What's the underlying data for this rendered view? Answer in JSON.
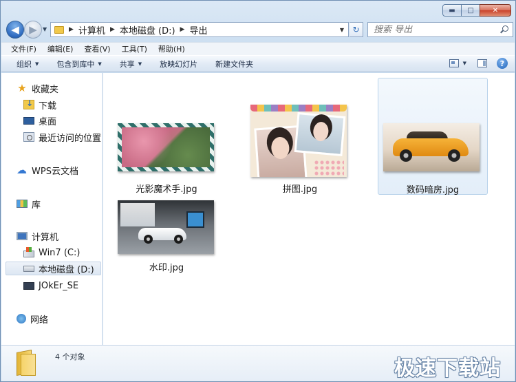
{
  "window": {
    "caption_buttons": {
      "minimize": "▬",
      "maximize": "□",
      "close": "✕"
    }
  },
  "navigation": {
    "back_glyph": "◀",
    "forward_glyph": "▶",
    "breadcrumbs": [
      "计算机",
      "本地磁盘 (D:)",
      "导出"
    ],
    "separator": "▶",
    "dropdown_glyph": "▼",
    "refresh_glyph": "↻",
    "search_placeholder": "搜索 导出"
  },
  "menubar": {
    "items": [
      "文件(F)",
      "编辑(E)",
      "查看(V)",
      "工具(T)",
      "帮助(H)"
    ]
  },
  "commandbar": {
    "items": [
      {
        "label": "组织",
        "has_dropdown": true
      },
      {
        "label": "包含到库中",
        "has_dropdown": true
      },
      {
        "label": "共享",
        "has_dropdown": true
      },
      {
        "label": "放映幻灯片",
        "has_dropdown": false
      },
      {
        "label": "新建文件夹",
        "has_dropdown": false
      }
    ],
    "dropdown_glyph": "▼",
    "help_glyph": "?"
  },
  "sidebar": {
    "favorites": {
      "label": "收藏夹",
      "icon": "star-icon"
    },
    "favorite_items": [
      {
        "label": "下载",
        "icon": "download-folder-icon"
      },
      {
        "label": "桌面",
        "icon": "desktop-icon"
      },
      {
        "label": "最近访问的位置",
        "icon": "recent-places-icon"
      }
    ],
    "wps": {
      "label": "WPS云文档",
      "icon": "cloud-icon"
    },
    "libraries": {
      "label": "库",
      "icon": "library-icon"
    },
    "computer": {
      "label": "计算机",
      "icon": "computer-icon"
    },
    "drives": [
      {
        "label": "Win7 (C:)",
        "icon": "system-drive-icon",
        "selected": false
      },
      {
        "label": "本地磁盘 (D:)",
        "icon": "drive-icon",
        "selected": true
      },
      {
        "label": "JOkEr_SE",
        "icon": "usb-drive-icon",
        "selected": false
      }
    ],
    "network": {
      "label": "网络",
      "icon": "network-icon"
    }
  },
  "files": [
    {
      "name": "光影魔术手.jpg",
      "selected": false
    },
    {
      "name": "拼图.jpg",
      "selected": false
    },
    {
      "name": "数码暗房.jpg",
      "selected": true
    },
    {
      "name": "水印.jpg",
      "selected": false
    }
  ],
  "details": {
    "count_text": "4 个对象",
    "icon": "folder-icon"
  },
  "watermark": {
    "text": "极速下载站"
  },
  "colors": {
    "window_frame": "#c8dbee",
    "selection": "#e3eef9",
    "accent": "#2e6bc0"
  }
}
